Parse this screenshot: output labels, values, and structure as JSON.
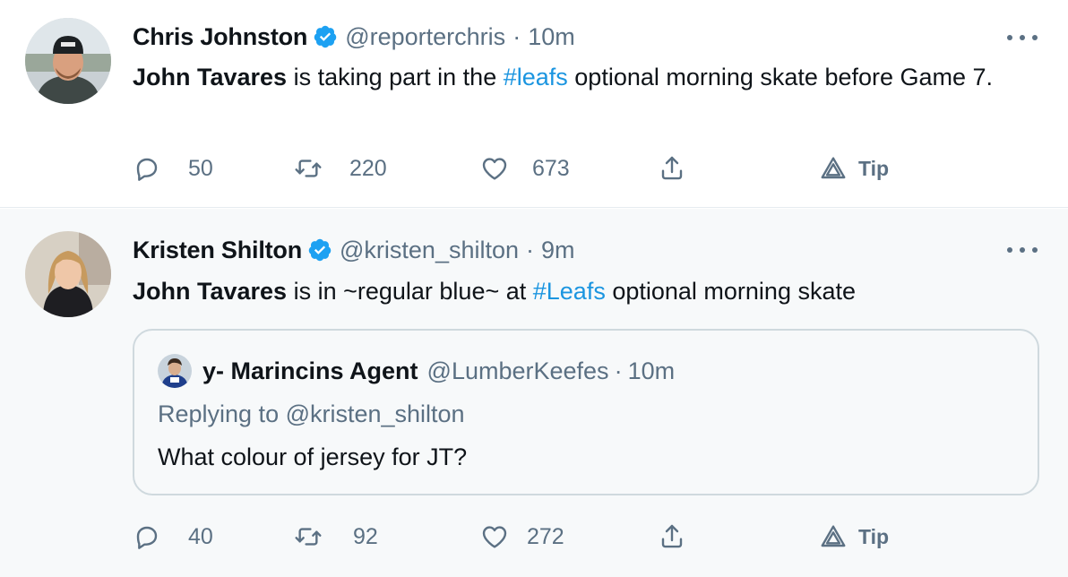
{
  "tweets": [
    {
      "author_name": "Chris Johnston",
      "handle": "@reporterchris",
      "separator": "·",
      "time": "10m",
      "text_bold": "John Tavares",
      "text_pre": " is taking part in the ",
      "hashtag": "#leafs",
      "text_post": " optional morning skate before Game 7.",
      "replies": "50",
      "retweets": "220",
      "likes": "673",
      "tip_label": "Tip"
    },
    {
      "author_name": "Kristen Shilton",
      "handle": "@kristen_shilton",
      "separator": "·",
      "time": "9m",
      "text_bold": "John Tavares",
      "text_pre": " is in ~regular blue~ at ",
      "hashtag": "#Leafs",
      "text_post": " optional morning skate",
      "quoted": {
        "author_name": "y- Marincins Agent",
        "handle": "@LumberKeefes",
        "separator": "·",
        "time": "10m",
        "reply_to": "Replying to @kristen_shilton",
        "text": "What colour of jersey for JT?"
      },
      "replies": "40",
      "retweets": "92",
      "likes": "272",
      "tip_label": "Tip"
    }
  ],
  "colors": {
    "verified": "#1da1f2",
    "hashtag": "#1b95e0",
    "muted": "#5b7083",
    "text": "#0f1419"
  },
  "icons": [
    "verified-badge-icon",
    "more-dots-icon",
    "reply-icon",
    "retweet-icon",
    "like-icon",
    "share-icon",
    "tip-icon"
  ]
}
